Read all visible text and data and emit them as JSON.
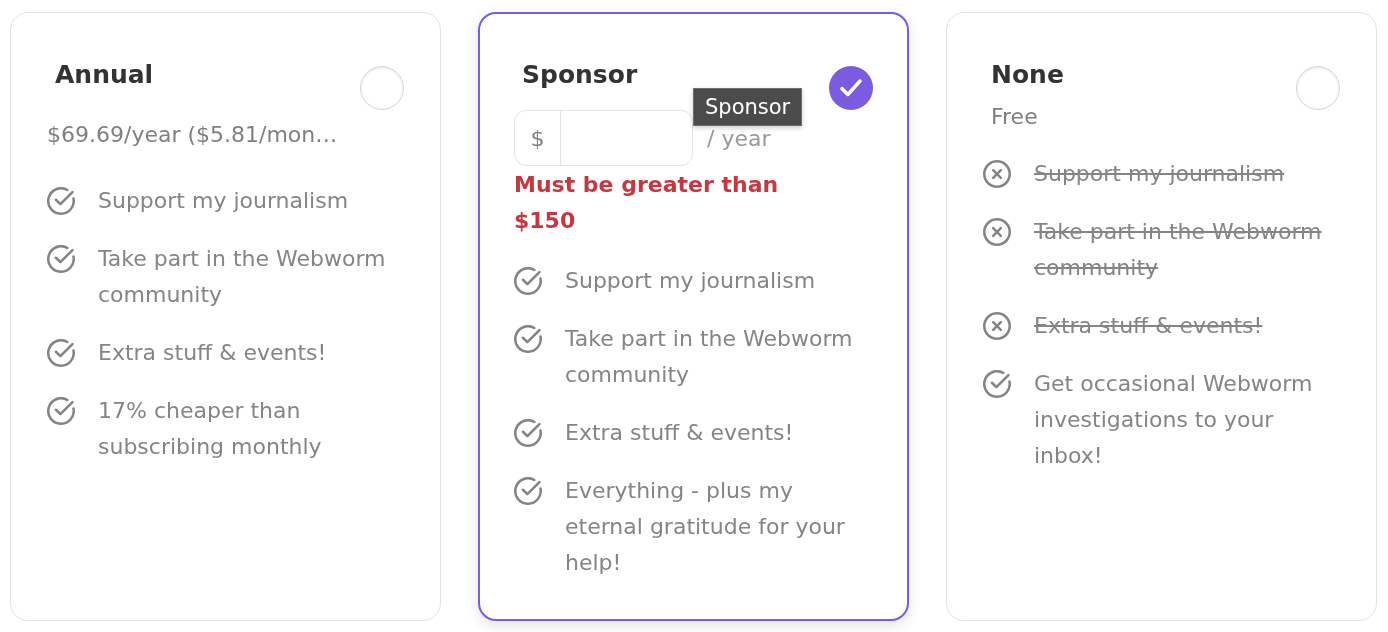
{
  "plans": [
    {
      "kind": "fixed",
      "name": "Annual",
      "selected": false,
      "price": "$69.69/year ($5.81/mon…",
      "features": [
        {
          "text": "Support my journalism",
          "included": true
        },
        {
          "text": "Take part in the Webworm community",
          "included": true
        },
        {
          "text": "Extra stuff & events!",
          "included": true
        },
        {
          "text": "17% cheaper than subscribing monthly",
          "included": true
        }
      ]
    },
    {
      "kind": "custom",
      "name": "Sponsor",
      "selected": true,
      "amount_field": {
        "prefix": "$",
        "suffix": "/ year"
      },
      "error": "Must be greater than $150",
      "tooltip": "Sponsor",
      "features": [
        {
          "text": "Support my journalism",
          "included": true
        },
        {
          "text": "Take part in the Webworm community",
          "included": true
        },
        {
          "text": "Extra stuff & events!",
          "included": true
        },
        {
          "text": "Everything - plus my eternal gratitude for your help!",
          "included": true
        }
      ]
    },
    {
      "kind": "free",
      "name": "None",
      "selected": false,
      "price": "Free",
      "features": [
        {
          "text": "Support my journalism",
          "included": false
        },
        {
          "text": "Take part in the Webworm community",
          "included": false
        },
        {
          "text": "Extra stuff & events!",
          "included": false
        },
        {
          "text": "Get occasional Webworm investigations to your inbox!",
          "included": true
        }
      ]
    }
  ]
}
